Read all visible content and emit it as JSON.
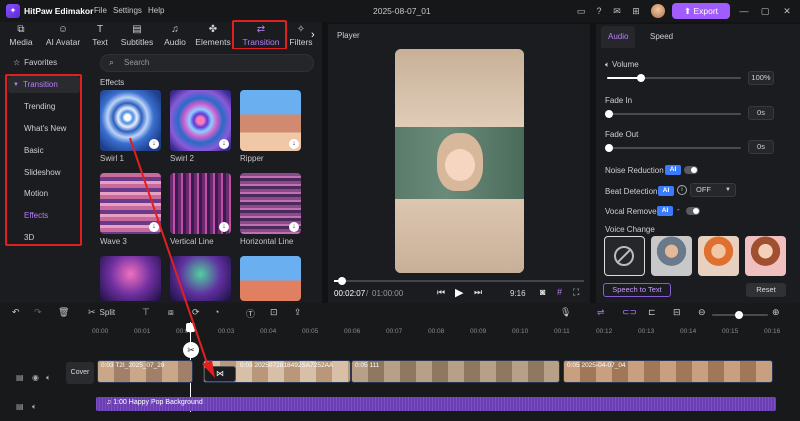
{
  "app": {
    "logo": "✦",
    "name": "HitPaw Edimakor",
    "menu": [
      "File",
      "Settings",
      "Help"
    ],
    "doc_title": "2025-08-07_01",
    "export_label": "Export"
  },
  "tooltabs": [
    {
      "label": "Media",
      "icon": "media-icon"
    },
    {
      "label": "AI Avatar",
      "icon": "avatar-icon"
    },
    {
      "label": "Text",
      "icon": "text-icon"
    },
    {
      "label": "Subtitles",
      "icon": "subtitles-icon"
    },
    {
      "label": "Audio",
      "icon": "audio-icon"
    },
    {
      "label": "Elements",
      "icon": "elements-icon"
    },
    {
      "label": "Transition",
      "icon": "transition-icon"
    },
    {
      "label": "Filters",
      "icon": "filters-icon"
    }
  ],
  "sidebar": {
    "favorites": "Favorites",
    "section": "Transition",
    "items": [
      "Trending",
      "What's New",
      "Basic",
      "Slideshow",
      "Motion",
      "Effects",
      "3D"
    ]
  },
  "effects": {
    "search_placeholder": "Search",
    "heading": "Effects",
    "items": [
      "Swirl 1",
      "Swirl 2",
      "Ripper",
      "Wave 3",
      "Vertical Line",
      "Horizontal Line"
    ]
  },
  "player": {
    "title": "Player",
    "current_time": "00:02:07",
    "total_time": "01:00:00",
    "aspect": "9:16",
    "progress": 0.03
  },
  "right": {
    "tabs": [
      "Audio",
      "Speed"
    ],
    "volume": {
      "label": "Volume",
      "value": "100%",
      "level": 1.0
    },
    "fade_in": {
      "label": "Fade In",
      "value": "0s"
    },
    "fade_out": {
      "label": "Fade Out",
      "value": "0s"
    },
    "noise_reduction": "Noise Reduction",
    "beat_detection": {
      "label": "Beat Detection",
      "value": "OFF"
    },
    "vocal_remover": "Vocal Remover",
    "voice_change": "Voice Change",
    "ai_badge": "AI",
    "speech_to_text": "Speech to Text",
    "reset": "Reset"
  },
  "timeline": {
    "split_label": "Split",
    "ticks": [
      "00:00",
      "00:01",
      "00:02",
      "00:03",
      "00:04",
      "00:05",
      "00:06",
      "00:07",
      "00:08",
      "00:09",
      "00:10",
      "00:11",
      "00:12",
      "00:13",
      "00:14",
      "00:15",
      "00:16"
    ],
    "cover_label": "Cover",
    "clips": [
      {
        "label": "0:03  T2I_2025_07_28"
      },
      {
        "label": "0:03  2025072818492SA7252AA"
      },
      {
        "label": "0:05  111"
      },
      {
        "label": "0:05  2025-04-07_04"
      }
    ],
    "audio_clip": "1:00  Happy Pop Background"
  }
}
